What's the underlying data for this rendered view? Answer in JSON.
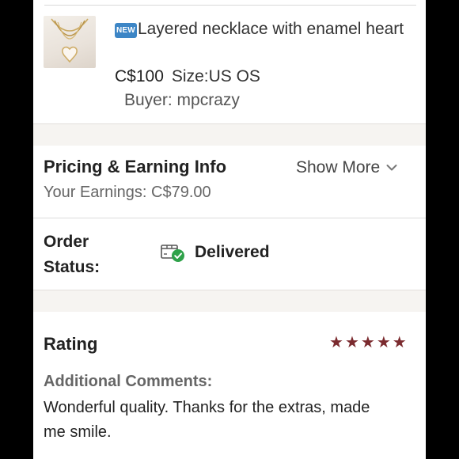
{
  "product": {
    "badge": "NEW",
    "title": "Layered necklace with enamel heart",
    "price": "C$100",
    "size": "Size:US OS",
    "buyer": "Buyer: mpcrazy"
  },
  "pricing": {
    "title": "Pricing & Earning Info",
    "show_more": "Show More",
    "earnings": "Your Earnings: C$79.00"
  },
  "order": {
    "label": "Order Status:",
    "status": "Delivered"
  },
  "rating": {
    "title": "Rating",
    "stars": 5,
    "star_color": "#7b2b2f",
    "comments_label": "Additional Comments:",
    "comments": "Wonderful quality. Thanks for the extras, made me smile."
  },
  "colors": {
    "badge_blue": "#3d86c6",
    "delivered_green": "#2fa24a"
  }
}
